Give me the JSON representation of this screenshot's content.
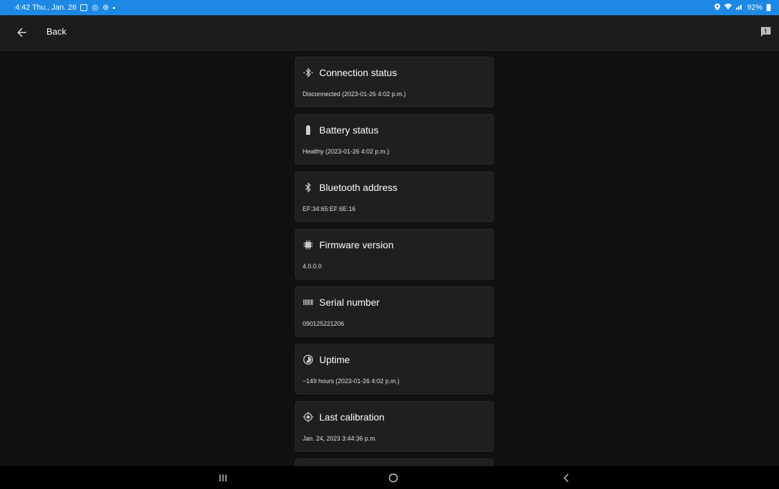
{
  "status_bar": {
    "time_date": "4:42  Thu., Jan. 26",
    "battery_text": "92%"
  },
  "app_bar": {
    "back_label": "Back"
  },
  "cards": [
    {
      "icon": "bluetooth-connect-icon",
      "title": "Connection status",
      "value": "Disconnected (2023-01-26 4:02 p.m.)"
    },
    {
      "icon": "battery-icon",
      "title": "Battery status",
      "value": "Healthy (2023-01-26 4:02 p.m.)"
    },
    {
      "icon": "bluetooth-icon",
      "title": "Bluetooth address",
      "value": "EF:34:65:EF:6E:16"
    },
    {
      "icon": "chip-icon",
      "title": "Firmware version",
      "value": "4.0.0.0"
    },
    {
      "icon": "barcode-icon",
      "title": "Serial number",
      "value": "090125221206"
    },
    {
      "icon": "timer-icon",
      "title": "Uptime",
      "value": "~149 hours (2023-01-26 4:02 p.m.)"
    },
    {
      "icon": "target-icon",
      "title": "Last calibration",
      "value": "Jan. 24, 2023 3:44:36 p.m."
    }
  ],
  "colors": {
    "status_bar": "#1e88e5",
    "background": "#111111",
    "card": "#1f1f1f"
  }
}
